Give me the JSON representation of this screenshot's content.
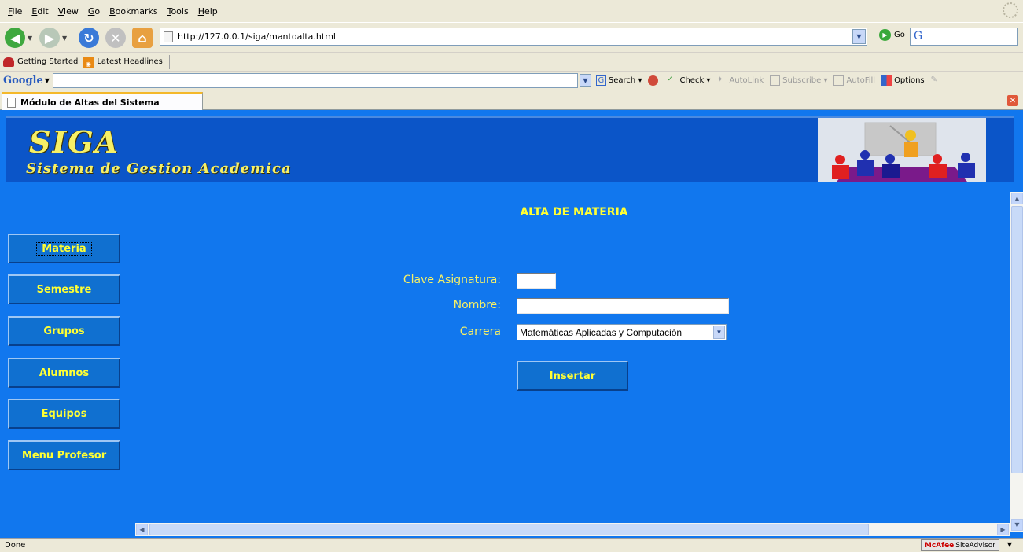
{
  "browser": {
    "menu": [
      "File",
      "Edit",
      "View",
      "Go",
      "Bookmarks",
      "Tools",
      "Help"
    ],
    "url": "http://127.0.0.1/siga/mantoalta.html",
    "go_label": "Go",
    "search_engine_glyph": "G",
    "bookmarks": [
      "Getting Started",
      "Latest Headlines"
    ],
    "google_toolbar": {
      "logo": "Google",
      "items": [
        "Search",
        "Check",
        "AutoLink",
        "Subscribe",
        "AutoFill",
        "Options"
      ]
    },
    "tab_title": "Módulo de Altas del Sistema",
    "status": "Done",
    "siteadvisor": {
      "brand": "McAfee",
      "product": "SiteAdvisor"
    }
  },
  "page": {
    "logo_title": "SIGA",
    "logo_subtitle": "Sistema de Gestion Academica",
    "heading": "ALTA DE MATERIA",
    "sidebar": [
      "Materia",
      "Semestre",
      "Grupos",
      "Alumnos",
      "Equipos",
      "Menu Profesor"
    ],
    "form": {
      "clave_label": "Clave Asignatura:",
      "clave_value": "",
      "nombre_label": "Nombre:",
      "nombre_value": "",
      "carrera_label": "Carrera",
      "carrera_selected": "Matemáticas Aplicadas y Computación",
      "submit_label": "Insertar"
    }
  },
  "colors": {
    "page_background": "#1177ee",
    "banner": "#0b55c8",
    "accent_text": "#ffff33"
  }
}
